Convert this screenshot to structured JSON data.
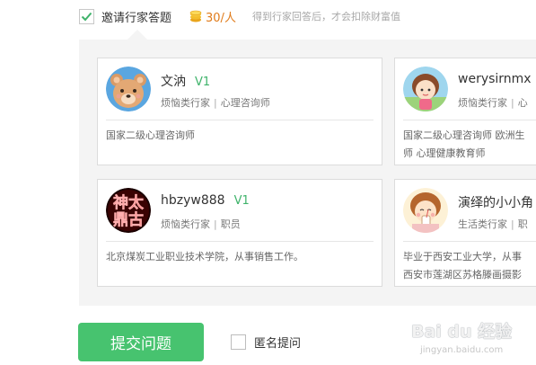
{
  "invite": {
    "label": "邀请行家答题",
    "checked": true,
    "price": "30/人",
    "hint": "得到行家回答后，才会扣除财富值"
  },
  "experts": [
    {
      "name": "文汭",
      "level": "V1",
      "tags": [
        "烦恼类行家",
        "心理咨询师"
      ],
      "desc": [
        "国家二级心理咨询师"
      ]
    },
    {
      "name": "werysirnmx",
      "level": "",
      "tags": [
        "烦恼类行家",
        "心"
      ],
      "desc": [
        "国家二级心理咨询师 欧洲生",
        "师 心理健康教育师"
      ]
    },
    {
      "name": "hbzyw888",
      "level": "V1",
      "tags": [
        "烦恼类行家",
        "职员"
      ],
      "desc": [
        "北京煤炭工业职业技术学院，从事销售工作。"
      ]
    },
    {
      "name": "演绎的小小角",
      "level": "",
      "tags": [
        "生活类行家",
        "职"
      ],
      "desc": [
        "毕业于西安工业大学，从事",
        "西安市莲湖区苏格滕画摄影"
      ]
    }
  ],
  "avatar_text": {
    "line1": "神太",
    "line2": "鼎古"
  },
  "actions": {
    "submit_label": "提交问题",
    "anonymous_label": "匿名提问",
    "anonymous_checked": false
  },
  "watermark": {
    "main": "Bai du 经验",
    "sub": "jingyan.baidu.com"
  },
  "colors": {
    "accent_green": "#47c36f",
    "level_green": "#3fb36b",
    "price_orange": "#e07b1a",
    "panel_bg": "#f4f4f4"
  },
  "icons": {
    "check": "check-icon",
    "coin": "coin-stack-icon"
  }
}
